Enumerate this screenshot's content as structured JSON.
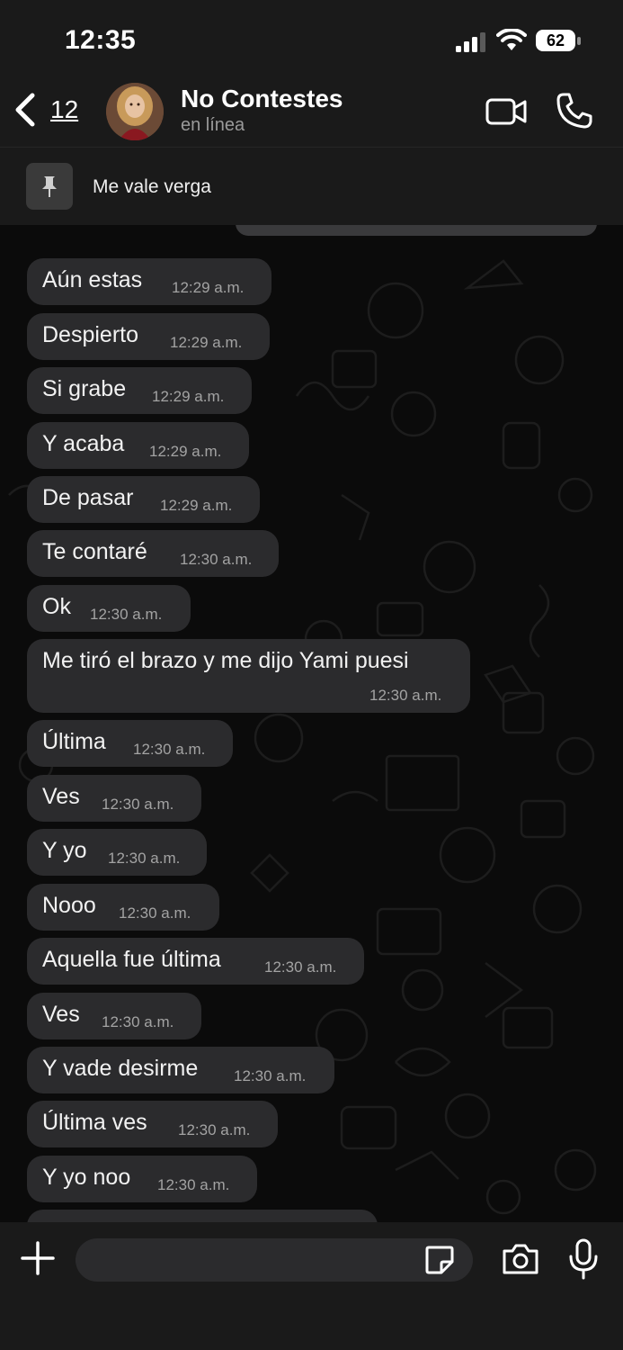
{
  "status_bar": {
    "time": "12:35",
    "battery": "62"
  },
  "header": {
    "back_count": "12",
    "contact_name": "No Contestes",
    "status": "en línea"
  },
  "pinned": {
    "text": "Me vale verga"
  },
  "messages": [
    {
      "text": "Aún estas",
      "time": "12:29 a.m."
    },
    {
      "text": "Despierto",
      "time": "12:29 a.m."
    },
    {
      "text": "Si grabe",
      "time": "12:29 a.m."
    },
    {
      "text": "Y acaba",
      "time": "12:29 a.m."
    },
    {
      "text": "De pasar",
      "time": "12:29 a.m."
    },
    {
      "text": "Te contaré",
      "time": "12:30 a.m."
    },
    {
      "text": "Ok",
      "time": "12:30 a.m."
    },
    {
      "text": "Me tiró el brazo y me dijo Yami puesi",
      "time": "12:30 a.m."
    },
    {
      "text": "Última",
      "time": "12:30 a.m."
    },
    {
      "text": "Ves",
      "time": "12:30 a.m."
    },
    {
      "text": "Y yo",
      "time": "12:30 a.m."
    },
    {
      "text": "Nooo",
      "time": "12:30 a.m."
    },
    {
      "text": "Aquella fue última",
      "time": "12:30 a.m."
    },
    {
      "text": "Ves",
      "time": "12:30 a.m."
    },
    {
      "text": "Y vade desirme",
      "time": "12:30 a.m."
    },
    {
      "text": "Última ves",
      "time": "12:30 a.m."
    },
    {
      "text": "Y yo noo",
      "time": "12:30 a.m."
    }
  ],
  "composer": {
    "value": ""
  },
  "colors": {
    "bubble": "#2b2b2d",
    "bar": "#1a1a1a",
    "background": "#0b0b0b"
  },
  "icons": [
    "back-chevron-icon",
    "video-call-icon",
    "phone-icon",
    "pin-icon",
    "chevron-down-icon",
    "plus-icon",
    "sticker-icon",
    "camera-icon",
    "microphone-icon"
  ]
}
